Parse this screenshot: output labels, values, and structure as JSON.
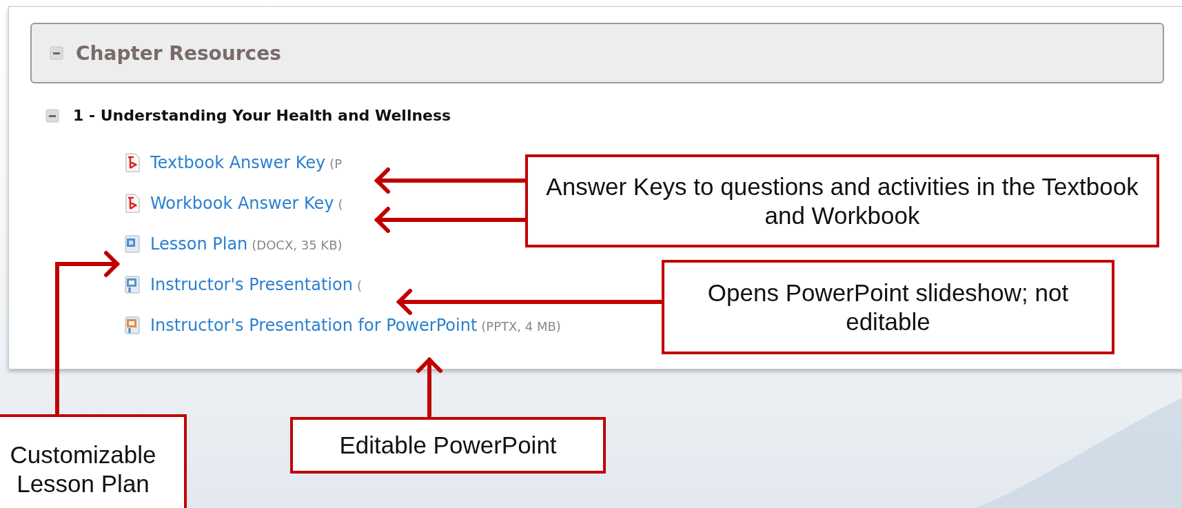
{
  "panel": {
    "title": "Chapter Resources",
    "expanded": true,
    "sections": [
      {
        "title": "1 - Understanding Your Health and Wellness",
        "expanded": true,
        "files": [
          {
            "kind": "pdf",
            "name": "Textbook Answer Key",
            "meta": "(P"
          },
          {
            "kind": "pdf",
            "name": "Workbook Answer Key",
            "meta": "("
          },
          {
            "kind": "docx",
            "name": "Lesson Plan",
            "meta": "(DOCX, 35 KB)"
          },
          {
            "kind": "ppsx",
            "name": "Instructor's Presentation",
            "meta": "("
          },
          {
            "kind": "pptx",
            "name": "Instructor's Presentation for PowerPoint",
            "meta": "(PPTX, 4 MB)"
          }
        ]
      }
    ]
  },
  "callouts": [
    {
      "text": "Answer Keys to questions and activities in the Textbook and Workbook"
    },
    {
      "text": "Opens PowerPoint slideshow; not editable"
    },
    {
      "text": "Editable PowerPoint"
    },
    {
      "text": "Customizable Lesson Plan"
    }
  ]
}
